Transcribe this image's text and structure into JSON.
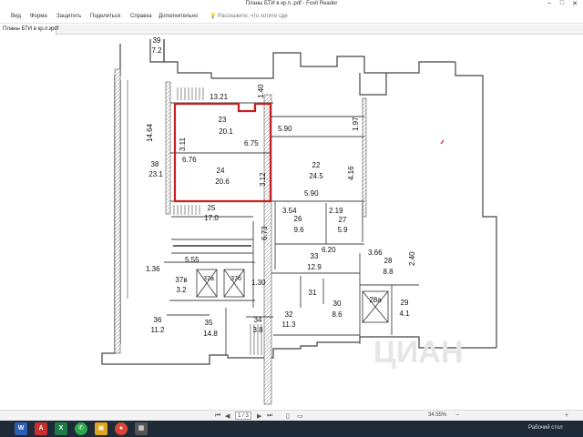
{
  "window": {
    "title": "Планы БТИ в кр.п..pdf - Foxit Reader"
  },
  "menu": {
    "items": [
      "Вид",
      "Форма",
      "Защитить",
      "Поделиться",
      "Справка",
      "Дополнительно"
    ],
    "tell_me": "Расскажите, что хотите сде"
  },
  "tab": {
    "label": "Планы БТИ в кр.п..pdf"
  },
  "status": {
    "page": "1 / 3",
    "zoom": "34.55%"
  },
  "taskbar": {
    "desktop_label": "Рабочий стол"
  },
  "plan": {
    "dims": {
      "top_wall": "13.21",
      "top_right_dim": "1.40",
      "left_wall": "14.64",
      "r23_side": "3.11",
      "r23_h": "6.75",
      "r24_w": "6.76",
      "r24_side": "3.12",
      "r22_top": "5.90",
      "r22_side_top": "1.97",
      "r22_side": "4.16",
      "r22_bottom": "5.90",
      "r26_w": "3.54",
      "r27_w": "2.19",
      "mid_v": "6.73",
      "r33_w": "6.20",
      "r28_w": "3.66",
      "r28_side": "2.40",
      "left_gap": "1.36",
      "stair_w": "5.55",
      "small_h": "1.30"
    },
    "rooms": [
      {
        "num": "39",
        "area": "7.2"
      },
      {
        "num": "23",
        "area": "20.1"
      },
      {
        "num": "24",
        "area": "20.6"
      },
      {
        "num": "22",
        "area": "24.5"
      },
      {
        "num": "38",
        "area": "23.1"
      },
      {
        "num": "25",
        "area": "17.0"
      },
      {
        "num": "26",
        "area": "9.6"
      },
      {
        "num": "27",
        "area": "5.9"
      },
      {
        "num": "33",
        "area": "12.9"
      },
      {
        "num": "28",
        "area": "8.8"
      },
      {
        "num": "37в",
        "area": "3.2"
      },
      {
        "num": "37а",
        "area": ""
      },
      {
        "num": "37б",
        "area": ""
      },
      {
        "num": "31",
        "area": ""
      },
      {
        "num": "30",
        "area": "8.6"
      },
      {
        "num": "28а",
        "area": ""
      },
      {
        "num": "29",
        "area": "4.1"
      },
      {
        "num": "36",
        "area": "11.2"
      },
      {
        "num": "35",
        "area": "14.8"
      },
      {
        "num": "34",
        "area": "3.8"
      },
      {
        "num": "32",
        "area": "11.3"
      }
    ],
    "watermark": "ЦИАН",
    "highlight_color": "#c81e1e"
  }
}
